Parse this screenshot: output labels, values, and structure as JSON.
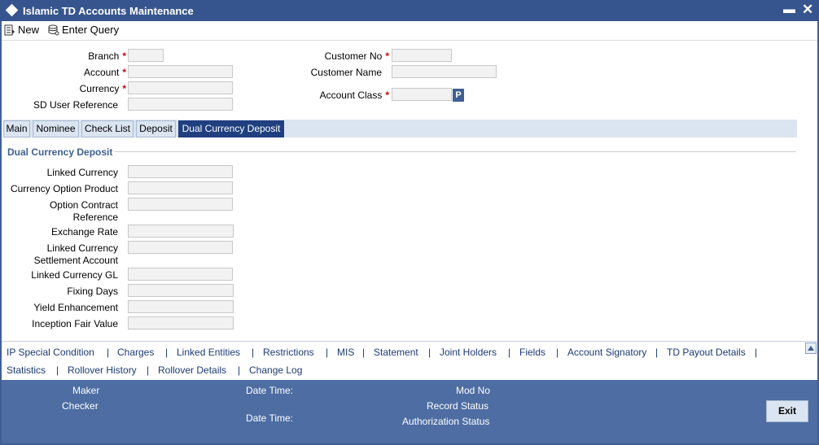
{
  "window": {
    "title": "Islamic TD Accounts Maintenance"
  },
  "toolbar": {
    "new_label": "New",
    "enter_query_label": "Enter Query"
  },
  "header_fields": {
    "branch": "Branch",
    "account": "Account",
    "currency": "Currency",
    "sd_user_reference": "SD User Reference",
    "customer_no": "Customer No",
    "customer_name": "Customer Name",
    "account_class": "Account Class",
    "required_marker": "*",
    "p_button": "P"
  },
  "tabs": [
    "Main",
    "Nominee",
    "Check List",
    "Deposit",
    "Dual Currency Deposit"
  ],
  "section": {
    "title": "Dual Currency Deposit"
  },
  "dcd_fields": {
    "linked_currency": "Linked Currency",
    "currency_option_product": "Currency Option Product",
    "option_contract_reference_1": "Option Contract",
    "option_contract_reference_2": "Reference",
    "exchange_rate": "Exchange Rate",
    "linked_currency_settlement_1": "Linked Currency",
    "linked_currency_settlement_2": "Settlement Account",
    "linked_currency_gl": "Linked Currency GL",
    "fixing_days": "Fixing Days",
    "yield_enhancement": "Yield Enhancement",
    "inception_fair_value": "Inception Fair Value"
  },
  "links": {
    "row1": [
      "IP Special Condition",
      "Charges",
      "Linked Entities",
      "Restrictions",
      "MIS",
      "Statement",
      "Joint Holders",
      "Fields",
      "Account Signatory",
      "TD Payout Details"
    ],
    "row2": [
      "Statistics",
      "Rollover History",
      "Rollover Details",
      "Change Log"
    ],
    "separator": "|"
  },
  "footer": {
    "maker": "Maker",
    "checker": "Checker",
    "date_time": "Date Time:",
    "mod_no": "Mod No",
    "record_status": "Record Status",
    "authorization_status": "Authorization Status",
    "exit": "Exit"
  },
  "colors": {
    "title_bar": "#36558f",
    "active_tab": "#1f3f7f",
    "footer": "#4d6da3",
    "link": "#1c3a78",
    "required": "#cc0000"
  }
}
